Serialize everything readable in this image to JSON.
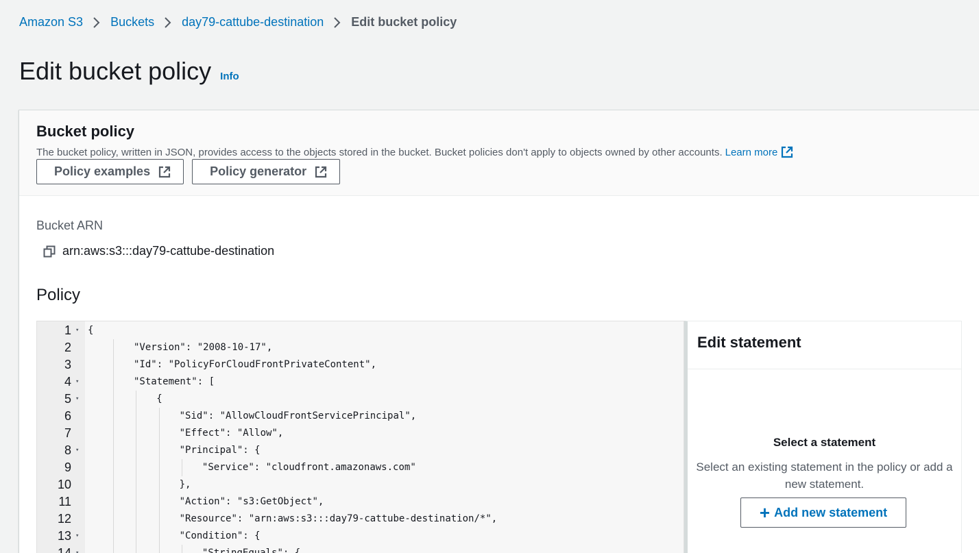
{
  "breadcrumb": {
    "items": [
      "Amazon S3",
      "Buckets",
      "day79-cattube-destination"
    ],
    "current": "Edit bucket policy"
  },
  "page": {
    "title": "Edit bucket policy",
    "info": "Info"
  },
  "bucket_policy": {
    "title": "Bucket policy",
    "description": "The bucket policy, written in JSON, provides access to the objects stored in the bucket. Bucket policies don't apply to objects owned by other accounts.",
    "learn_more": "Learn more",
    "policy_examples_button": "Policy examples",
    "policy_generator_button": "Policy generator"
  },
  "arn": {
    "label": "Bucket ARN",
    "value": "arn:aws:s3:::day79-cattube-destination"
  },
  "policy": {
    "label": "Policy",
    "lines": [
      {
        "num": "1",
        "fold": true,
        "indent": 0,
        "text": "{"
      },
      {
        "num": "2",
        "fold": false,
        "indent": 1,
        "text": "\"Version\": \"2008-10-17\","
      },
      {
        "num": "3",
        "fold": false,
        "indent": 1,
        "text": "\"Id\": \"PolicyForCloudFrontPrivateContent\","
      },
      {
        "num": "4",
        "fold": true,
        "indent": 1,
        "text": "\"Statement\": ["
      },
      {
        "num": "5",
        "fold": true,
        "indent": 2,
        "text": "{"
      },
      {
        "num": "6",
        "fold": false,
        "indent": 3,
        "text": "\"Sid\": \"AllowCloudFrontServicePrincipal\","
      },
      {
        "num": "7",
        "fold": false,
        "indent": 3,
        "text": "\"Effect\": \"Allow\","
      },
      {
        "num": "8",
        "fold": true,
        "indent": 3,
        "text": "\"Principal\": {"
      },
      {
        "num": "9",
        "fold": false,
        "indent": 4,
        "text": "\"Service\": \"cloudfront.amazonaws.com\""
      },
      {
        "num": "10",
        "fold": false,
        "indent": 3,
        "text": "},"
      },
      {
        "num": "11",
        "fold": false,
        "indent": 3,
        "text": "\"Action\": \"s3:GetObject\","
      },
      {
        "num": "12",
        "fold": false,
        "indent": 3,
        "text": "\"Resource\": \"arn:aws:s3:::day79-cattube-destination/*\","
      },
      {
        "num": "13",
        "fold": true,
        "indent": 3,
        "text": "\"Condition\": {"
      },
      {
        "num": "14",
        "fold": true,
        "indent": 4,
        "text": "\"StringEquals\": {"
      }
    ]
  },
  "edit_statement": {
    "title": "Edit statement",
    "select_title": "Select a statement",
    "select_desc": "Select an existing statement in the policy or add a new statement.",
    "add_button": "Add new statement"
  },
  "colors": {
    "link": "#0073bb",
    "text": "#16191f",
    "muted": "#545b64",
    "background": "#f2f3f3"
  }
}
